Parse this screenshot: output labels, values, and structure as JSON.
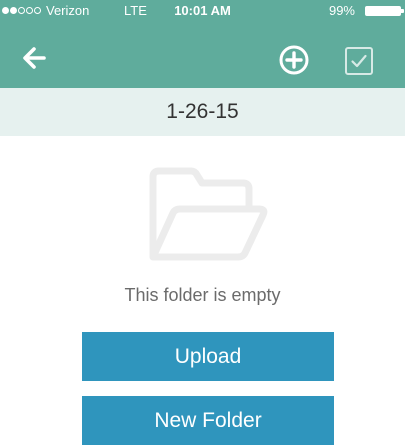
{
  "status_bar": {
    "carrier": "Verizon",
    "network": "LTE",
    "time": "10:01 AM",
    "battery": "99%",
    "signal_strength": 2
  },
  "header": {
    "background": "#5fac9c",
    "back_icon": "arrow-left-icon",
    "add_icon": "plus-circle-icon",
    "select_icon": "checkbox-icon"
  },
  "folder": {
    "name": "1-26-15",
    "empty_icon": "folder-outline-icon",
    "empty_message": "This folder is empty"
  },
  "actions": {
    "upload_label": "Upload",
    "new_folder_label": "New Folder",
    "button_color": "#2f95bd"
  }
}
